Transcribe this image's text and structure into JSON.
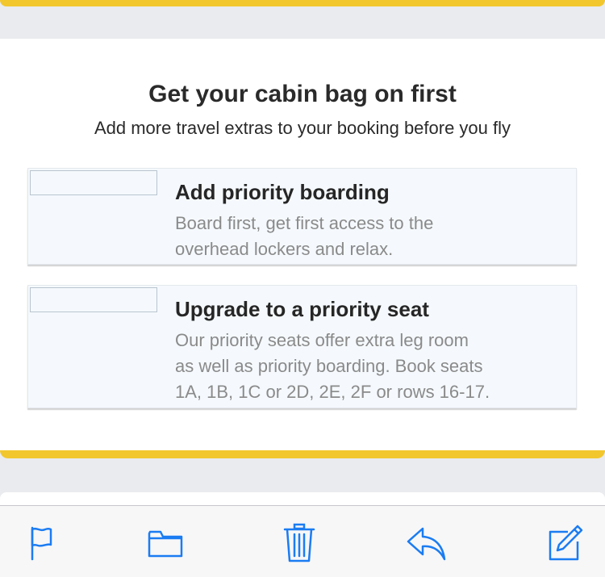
{
  "promo": {
    "title": "Get your cabin bag on first",
    "subtitle": "Add more travel extras to your booking before you fly"
  },
  "offers": [
    {
      "title": "Add priority boarding",
      "description": "Board first, get first access to the\noverhead lockers and relax."
    },
    {
      "title": "Upgrade to a priority seat",
      "description": "Our priority seats offer extra leg room\nas well as priority boarding. Book seats\n1A, 1B, 1C or 2D, 2E, 2F or rows 16-17."
    }
  ],
  "toolbar": {
    "icons": [
      "flag-icon",
      "folder-icon",
      "trash-icon",
      "reply-icon",
      "compose-icon"
    ]
  },
  "colors": {
    "accent_yellow": "#f2c72d",
    "ios_blue": "#1b7cf2",
    "offer_background": "#f5f9fd",
    "page_background": "#e9ebee"
  }
}
